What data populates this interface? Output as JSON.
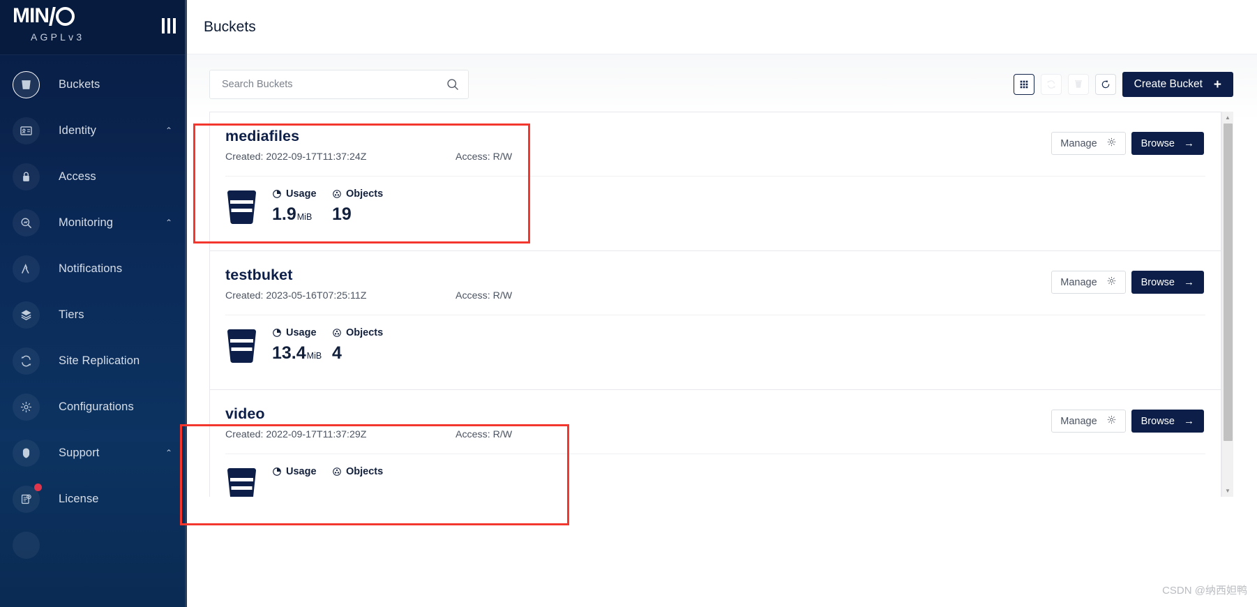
{
  "sidebar": {
    "brand": {
      "logo_text": "MINIO",
      "sub_text": "AGPLv3"
    },
    "menu_toggle": "menu-toggle",
    "items": [
      {
        "label": "Buckets",
        "icon": "bucket-icon",
        "active": true,
        "chevron": ""
      },
      {
        "label": "Identity",
        "icon": "identity-card-icon",
        "active": false,
        "chevron": "⌃"
      },
      {
        "label": "Access",
        "icon": "lock-icon",
        "active": false,
        "chevron": ""
      },
      {
        "label": "Monitoring",
        "icon": "magnifier-chart-icon",
        "active": false,
        "chevron": "⌃"
      },
      {
        "label": "Notifications",
        "icon": "lambda-icon",
        "active": false,
        "chevron": ""
      },
      {
        "label": "Tiers",
        "icon": "layers-icon",
        "active": false,
        "chevron": ""
      },
      {
        "label": "Site Replication",
        "icon": "sync-arrows-icon",
        "active": false,
        "chevron": ""
      },
      {
        "label": "Configurations",
        "icon": "gear-icon",
        "active": false,
        "chevron": ""
      },
      {
        "label": "Support",
        "icon": "headset-icon",
        "active": false,
        "chevron": "⌃"
      },
      {
        "label": "License",
        "icon": "license-doc-icon",
        "active": false,
        "chevron": "",
        "badge": true
      }
    ]
  },
  "header": {
    "title": "Buckets"
  },
  "search": {
    "placeholder": "Search Buckets",
    "value": "",
    "icon": "search-icon"
  },
  "toolbar": {
    "buttons": [
      {
        "name": "grid-view-button",
        "icon": "grid-icon",
        "state": "selected"
      },
      {
        "name": "sync-button",
        "icon": "sync-icon",
        "state": "disabled"
      },
      {
        "name": "delete-button",
        "icon": "trash-icon",
        "state": "disabled"
      },
      {
        "name": "refresh-button",
        "icon": "refresh-icon",
        "state": "enabled"
      }
    ],
    "create_label": "Create Bucket",
    "create_plus": "+"
  },
  "card_labels": {
    "created_prefix": "Created: ",
    "access_prefix": "Access: ",
    "usage": "Usage",
    "objects": "Objects",
    "manage": "Manage",
    "browse": "Browse",
    "browse_arrow": "→"
  },
  "buckets": [
    {
      "name": "mediafiles",
      "created": "Created: 2022-09-17T11:37:24Z",
      "access": "Access: R/W",
      "usage_value": "1.9",
      "usage_unit": "MiB",
      "objects": "19",
      "highlighted": true
    },
    {
      "name": "testbuket",
      "created": "Created: 2023-05-16T07:25:11Z",
      "access": "Access: R/W",
      "usage_value": "13.4",
      "usage_unit": "MiB",
      "objects": "4",
      "highlighted": false
    },
    {
      "name": "video",
      "created": "Created: 2022-09-17T11:37:29Z",
      "access": "Access: R/W",
      "usage_value": "",
      "usage_unit": "",
      "objects": "",
      "highlighted": true
    }
  ],
  "scrollbar": {
    "up": "▲",
    "down": "▼"
  },
  "watermark": "CSDN @纳西妲鸭",
  "colors": {
    "sidebar_top": "#071B3F",
    "sidebar_mid": "#0C3361",
    "accent_navy": "#0D1F48",
    "annotation_red": "#F4372E",
    "badge_red": "#E0354B"
  }
}
